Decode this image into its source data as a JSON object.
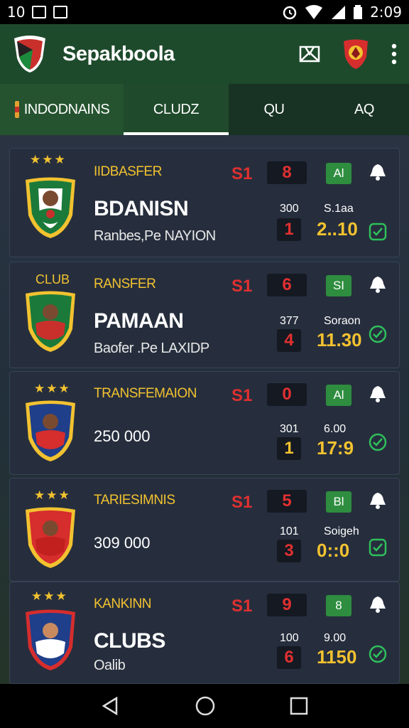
{
  "status": {
    "left_time": "10",
    "right_time": "2:09"
  },
  "app": {
    "title": "Sepakboola"
  },
  "tabs": [
    {
      "label": "INDODNAINS",
      "active": false
    },
    {
      "label": "CLUDZ",
      "active": true
    },
    {
      "label": "QU",
      "active": false
    },
    {
      "label": "AQ",
      "active": false
    }
  ],
  "cards": [
    {
      "badge_label": "",
      "stars": "★★★",
      "category": "IIDBASFER",
      "name": "BDANISN",
      "subtitle": "Ranbes,Pe NAYION",
      "price": "",
      "s1": "S1",
      "score": "8",
      "tag": "Al",
      "small_num": "300",
      "num": "1",
      "num_color": "red",
      "time_top": "S.1aa",
      "time": "2..10"
    },
    {
      "badge_label": "CLUB",
      "stars": "",
      "category": "RANSFER",
      "name": "PAMAAN",
      "subtitle": "Baofer .Pe LAXIDP",
      "price": "",
      "s1": "S1",
      "score": "6",
      "tag": "SI",
      "small_num": "377",
      "num": "4",
      "num_color": "red",
      "time_top": "Soraon",
      "time": "11.30"
    },
    {
      "badge_label": "",
      "stars": "★★★",
      "category": "TRANSFEMAION",
      "name": "",
      "subtitle": "",
      "price": "250 000",
      "s1": "S1",
      "score": "0",
      "tag": "Al",
      "small_num": "301",
      "num": "1",
      "num_color": "yellow",
      "time_top": "6.00",
      "time": "17:9"
    },
    {
      "badge_label": "",
      "stars": "★★★",
      "category": "TARIESIMNIS",
      "name": "",
      "subtitle": "",
      "price": "309 000",
      "s1": "S1",
      "score": "5",
      "tag": "Bl",
      "small_num": "101",
      "num": "3",
      "num_color": "red",
      "time_top": "Soigeh",
      "time": "0::0"
    },
    {
      "badge_label": "",
      "stars": "★★★",
      "category": "KANKINN",
      "name": "CLUBS",
      "subtitle": "Oalib",
      "price": "",
      "s1": "S1",
      "score": "9",
      "tag": "8",
      "small_num": "100",
      "num": "6",
      "num_color": "red",
      "time_top": "9.00",
      "time": "1150"
    }
  ],
  "colors": {
    "accent_green": "#1e4a2c",
    "highlight_yellow": "#f2c230",
    "score_red": "#e03030"
  },
  "icons": [
    "app-logo-icon",
    "map-icon",
    "club-crest-icon",
    "more-vert-icon",
    "bell-icon",
    "check-icon",
    "back-icon",
    "home-icon",
    "recents-icon"
  ]
}
